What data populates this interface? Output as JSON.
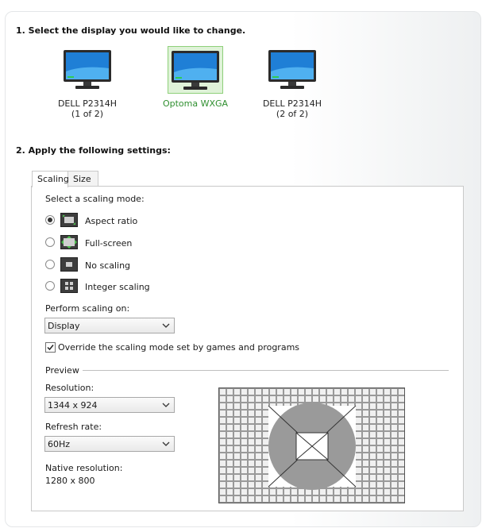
{
  "step1": {
    "heading": "1. Select the display you would like to change."
  },
  "displays": [
    {
      "name": "DELL P2314H",
      "sub": "(1 of 2)",
      "selected": false
    },
    {
      "name": "Optoma WXGA",
      "sub": "",
      "selected": true
    },
    {
      "name": "DELL P2314H",
      "sub": "(2 of 2)",
      "selected": false
    }
  ],
  "step2": {
    "heading": "2. Apply the following settings:"
  },
  "tabs": [
    {
      "label": "Scaling",
      "active": true
    },
    {
      "label": "Size",
      "active": false
    }
  ],
  "scaling": {
    "mode_label": "Select a scaling mode:",
    "modes": [
      {
        "label": "Aspect ratio",
        "checked": true,
        "icon": "aspect-ratio-icon"
      },
      {
        "label": "Full-screen",
        "checked": false,
        "icon": "full-screen-icon"
      },
      {
        "label": "No scaling",
        "checked": false,
        "icon": "no-scaling-icon"
      },
      {
        "label": "Integer scaling",
        "checked": false,
        "icon": "integer-scaling-icon"
      }
    ],
    "perform_on_label": "Perform scaling on:",
    "perform_on_value": "Display",
    "override_label": "Override the scaling mode set by games and programs",
    "override_checked": true
  },
  "preview": {
    "title": "Preview",
    "resolution_label": "Resolution:",
    "resolution_value": "1344 x 924",
    "refresh_label": "Refresh rate:",
    "refresh_value": "60Hz",
    "native_label": "Native resolution:",
    "native_value": "1280 x 800"
  },
  "colors": {
    "selected_text": "#2f8f2f",
    "selected_bg": "#dff2d8",
    "selected_border": "#8fd07a",
    "preview_gray": "#999999"
  }
}
